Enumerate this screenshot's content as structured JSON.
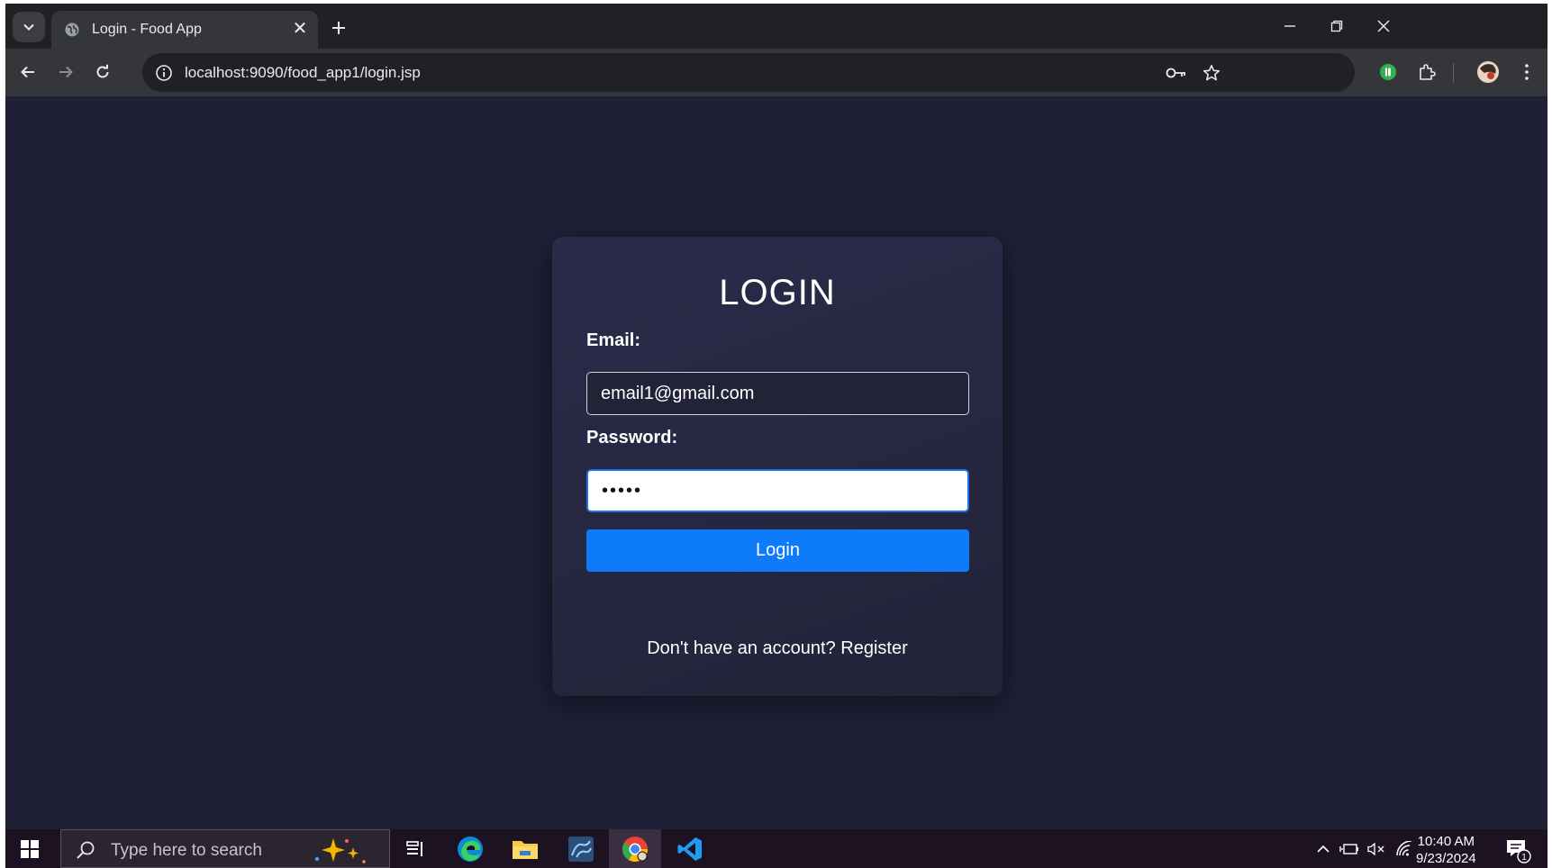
{
  "browser": {
    "tab": {
      "title": "Login - Food App",
      "close_glyph": "✕"
    },
    "address": {
      "url": "localhost:9090/food_app1/login.jsp"
    }
  },
  "login": {
    "title": "LOGIN",
    "email_label": "Email:",
    "email_value": "email1@gmail.com",
    "password_label": "Password:",
    "password_value": "•••••",
    "login_button": "Login",
    "register_prompt": "Don't have an account?",
    "register_link": "Register"
  },
  "taskbar": {
    "search_placeholder": "Type here to search",
    "clock_time": "10:40 AM",
    "clock_date": "9/23/2024",
    "notification_count": "1"
  },
  "colors": {
    "page_background": "#1f1f36",
    "card_background": "#2a2b4a",
    "button_blue": "#0d7bfa",
    "taskbar_background": "#1d1222"
  }
}
